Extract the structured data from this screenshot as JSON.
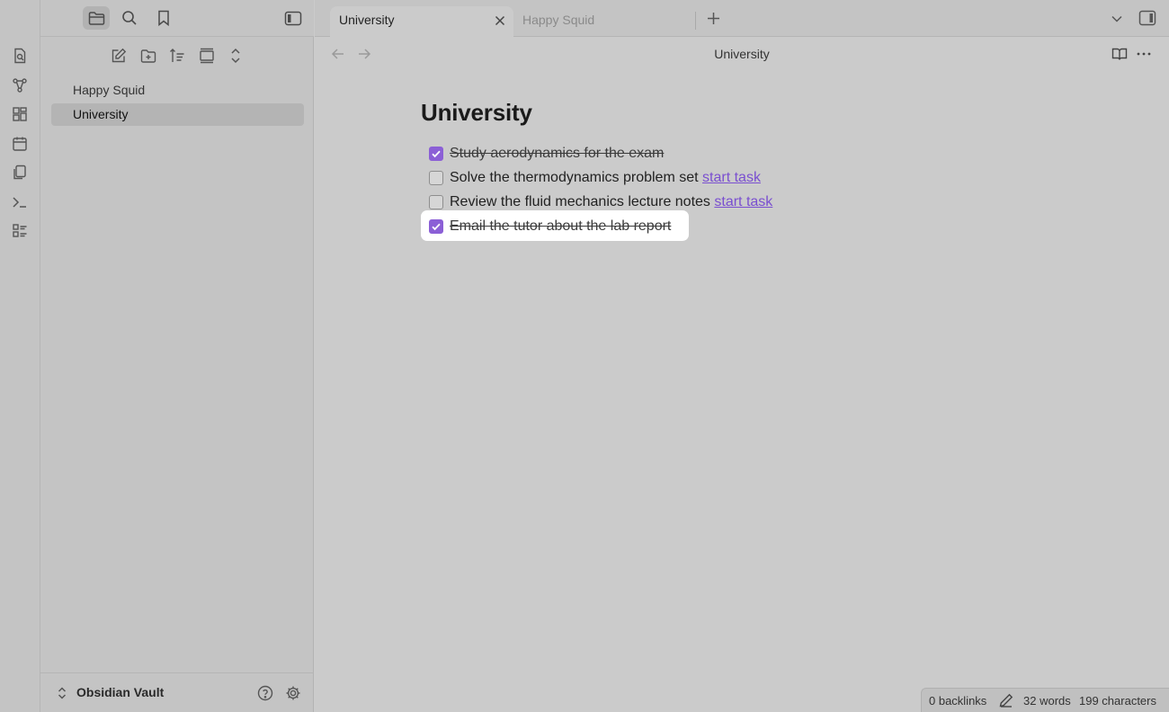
{
  "ribbon": {
    "items": [
      {
        "icon": "quick-switcher-icon"
      },
      {
        "icon": "graph-view-icon"
      },
      {
        "icon": "canvas-icon"
      },
      {
        "icon": "daily-note-icon"
      },
      {
        "icon": "templates-icon"
      },
      {
        "icon": "command-palette-icon"
      },
      {
        "icon": "slides-icon"
      }
    ]
  },
  "sidebar": {
    "files": [
      {
        "name": "Happy Squid"
      },
      {
        "name": "University"
      }
    ],
    "vault_name": "Obsidian Vault"
  },
  "tabs": [
    {
      "label": "University",
      "active": true
    },
    {
      "label": "Happy Squid",
      "active": false
    }
  ],
  "view": {
    "title": "University"
  },
  "document": {
    "heading": "University",
    "tasks": [
      {
        "text": "Study aerodynamics for the exam",
        "done": true,
        "link": ""
      },
      {
        "text": "Solve the thermodynamics problem set",
        "done": false,
        "link": "start task"
      },
      {
        "text": "Review the fluid mechanics lecture notes",
        "done": false,
        "link": "start task"
      },
      {
        "text": "Email the tutor about the lab report",
        "done": true,
        "link": ""
      }
    ]
  },
  "status": {
    "backlinks": "0 backlinks",
    "words": "32 words",
    "characters": "199 characters"
  },
  "colors": {
    "accent": "#8b5fd6",
    "link": "#7a4fd0",
    "background": "#cbcbcb"
  }
}
